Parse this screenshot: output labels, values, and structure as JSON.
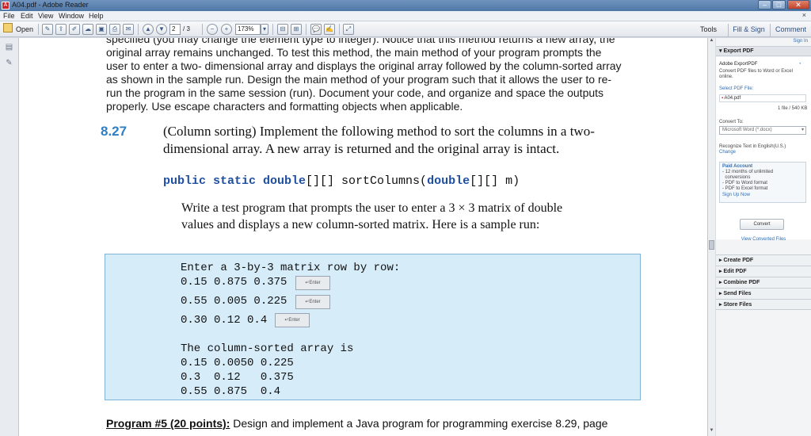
{
  "window": {
    "title": "A04.pdf - Adobe Reader",
    "min": "–",
    "max": "□",
    "close": "✕"
  },
  "menu": [
    "File",
    "Edit",
    "View",
    "Window",
    "Help"
  ],
  "toolbar": {
    "open": "Open",
    "page_current": "2",
    "page_total": "/ 3",
    "zoom": "173%",
    "tools": "Tools",
    "fill_sign": "Fill & Sign",
    "comment": "Comment"
  },
  "document": {
    "para_lines": [
      "specified (you may change the element type to integer). Notice that this method returns a new array, the",
      "original array remains unchanged. To test this method, the main method of your program prompts the",
      "user to enter a two- dimensional array and displays the original array followed by the column-sorted array",
      "as shown in the sample run. Design the main method of your program such that it allows the user to re-",
      "run the program in the same session (run). Document your code, and organize and space the outputs",
      "properly. Use escape characters and formatting objects when applicable."
    ],
    "section_number": "8.27",
    "section_lines": [
      "(Column sorting) Implement the following method to sort the columns in a two-",
      "dimensional array. A new array is returned and the original array is intact."
    ],
    "code": {
      "kw1": "public static double",
      "mid": "[][] sortColumns(",
      "kw2": "double",
      "end": "[][] m)"
    },
    "desc_lines": [
      "Write a test program that prompts the user to enter a 3 × 3 matrix of double",
      "values and displays a new column-sorted matrix. Here is a sample run:"
    ],
    "sample": {
      "prompt": "Enter a 3-by-3 matrix row by row:",
      "rows": [
        "0.15 0.875 0.375",
        "0.55 0.005 0.225",
        "0.30 0.12 0.4"
      ],
      "enter_label": "↵Enter",
      "result_header": "The column-sorted array is",
      "result_rows": [
        "0.15 0.0050 0.225",
        "0.3  0.12   0.375",
        "0.55 0.875  0.4"
      ]
    },
    "program_label": "Program #5 (20 points):",
    "program_text": " Design and implement a Java program for programming exercise 8.29, page"
  },
  "right_panel": {
    "signin": "Sign In",
    "export_header": "Export PDF",
    "adobe_exportpdf": "Adobe ExportPDF",
    "convert_desc_1": "Convert PDF files to Word or Excel",
    "convert_desc_2": "online.",
    "select_file": "Select PDF File:",
    "file_name": "A04.pdf",
    "file_count": "1 file / 540 KB",
    "convert_to": "Convert To:",
    "convert_format": "Microsoft Word (*.docx)",
    "recognize_text": "Recognize Text in English(U.S.)",
    "change": "Change",
    "paid_title": "Paid Account",
    "paid_items": [
      "- 12 months of unlimited",
      "  conversions",
      "- PDF to Word format",
      "- PDF to Excel format"
    ],
    "sign_up": "Sign Up Now",
    "convert_button": "Convert",
    "view_converted": "View Converted Files",
    "sections": [
      "Create PDF",
      "Edit PDF",
      "Combine PDF",
      "Send Files",
      "Store Files"
    ]
  }
}
